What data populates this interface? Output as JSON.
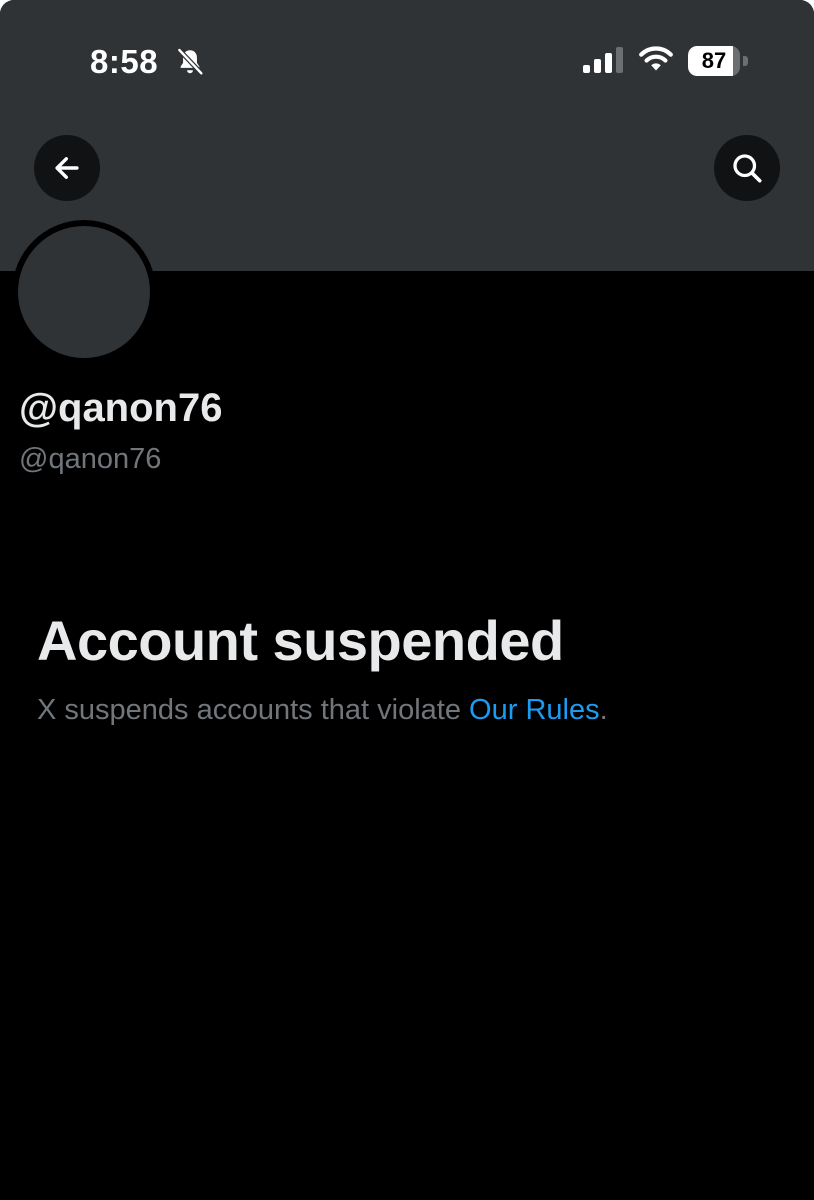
{
  "status_bar": {
    "time": "8:58",
    "battery_level": "87",
    "battery_fraction": 0.87,
    "icons": [
      "bell-slash-icon",
      "cellular-signal-icon",
      "wifi-icon",
      "battery-icon"
    ]
  },
  "nav": {
    "back_icon": "arrow-left-icon",
    "search_icon": "search-icon"
  },
  "profile": {
    "display_name": "@qanon76",
    "handle": "@qanon76"
  },
  "suspension": {
    "title": "Account suspended",
    "message_prefix": "X suspends accounts that violate ",
    "link_text": "Our Rules",
    "message_suffix": "."
  },
  "colors": {
    "background": "#000000",
    "banner": "#2f3336",
    "primary_text": "#e7e9ea",
    "secondary_text": "#71767b",
    "link": "#1d9bf0"
  }
}
